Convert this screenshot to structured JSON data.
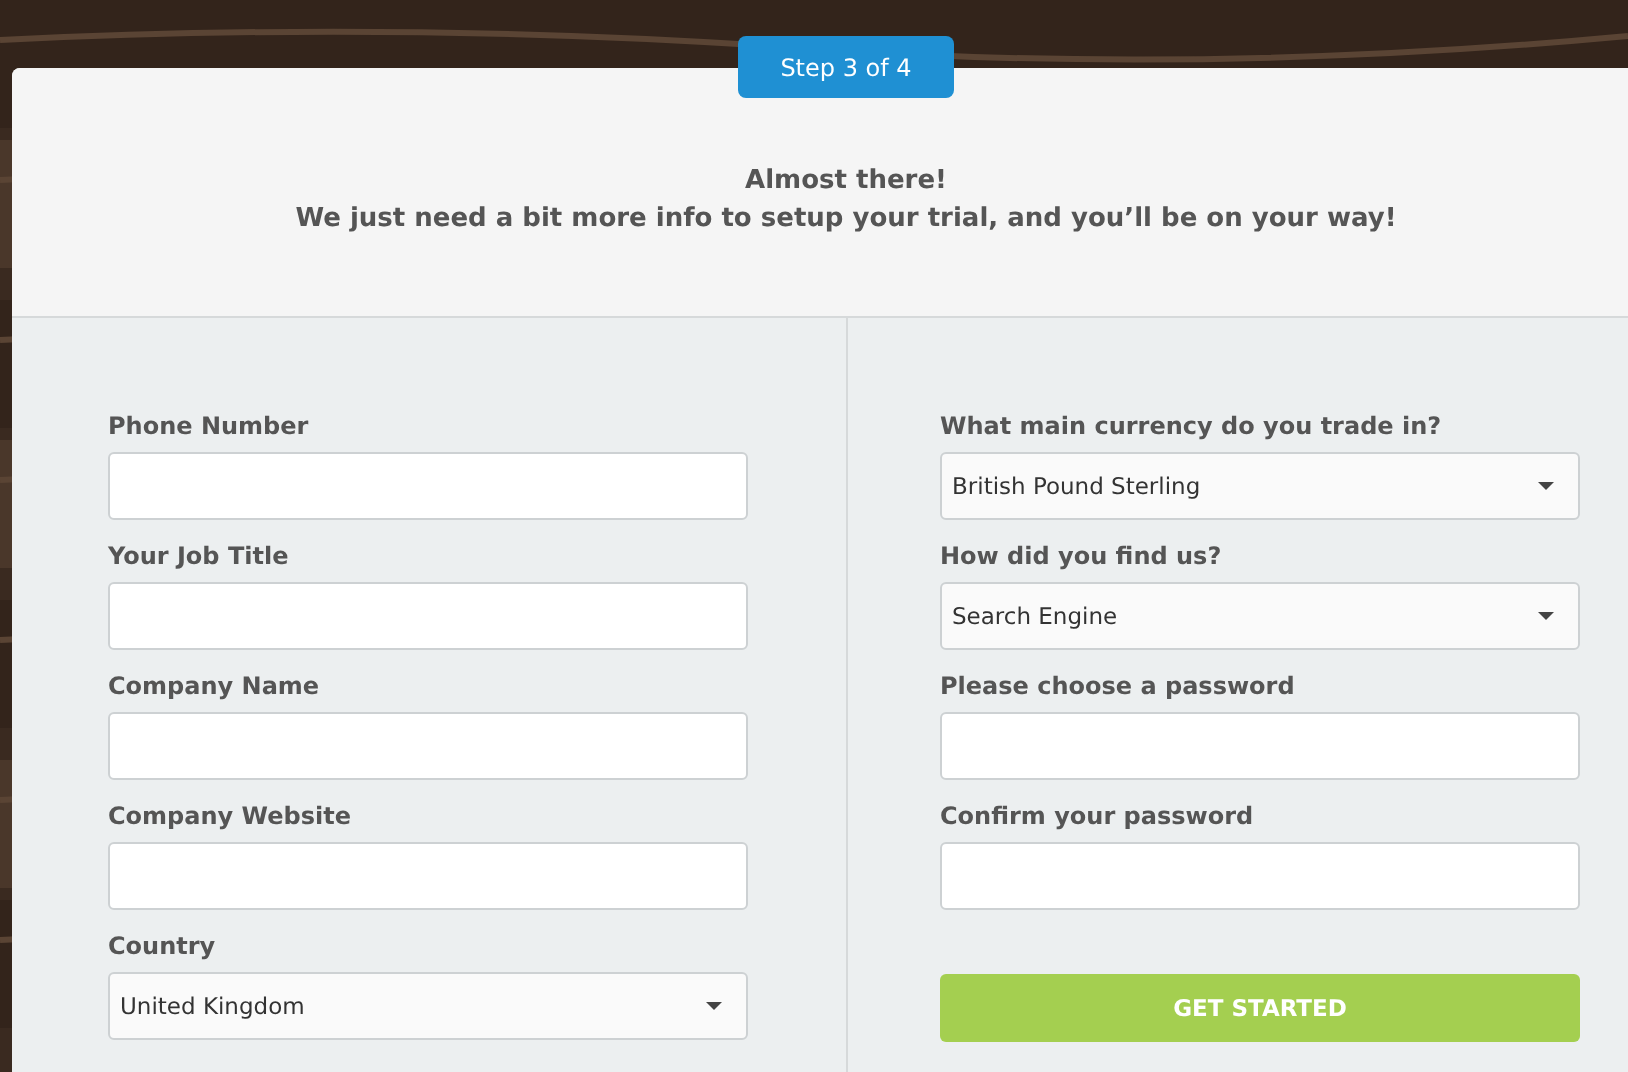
{
  "step_badge": "Step 3 of 4",
  "header": {
    "title": "Almost there!",
    "subtitle": "We just need a bit more info to setup your trial, and you’ll be on your way!"
  },
  "left_fields": [
    {
      "kind": "text",
      "label": "Phone Number"
    },
    {
      "kind": "text",
      "label": "Your Job Title"
    },
    {
      "kind": "text",
      "label": "Company Name"
    },
    {
      "kind": "text",
      "label": "Company Website"
    },
    {
      "kind": "select",
      "label": "Country",
      "value": "United Kingdom"
    }
  ],
  "right_fields": [
    {
      "kind": "select",
      "label": "What main currency do you trade in?",
      "value": "British Pound Sterling"
    },
    {
      "kind": "select",
      "label": "How did you find us?",
      "value": "Search Engine"
    },
    {
      "kind": "password",
      "label": "Please choose a password"
    },
    {
      "kind": "password",
      "label": "Confirm your password"
    }
  ],
  "submit_button": "GET STARTED"
}
